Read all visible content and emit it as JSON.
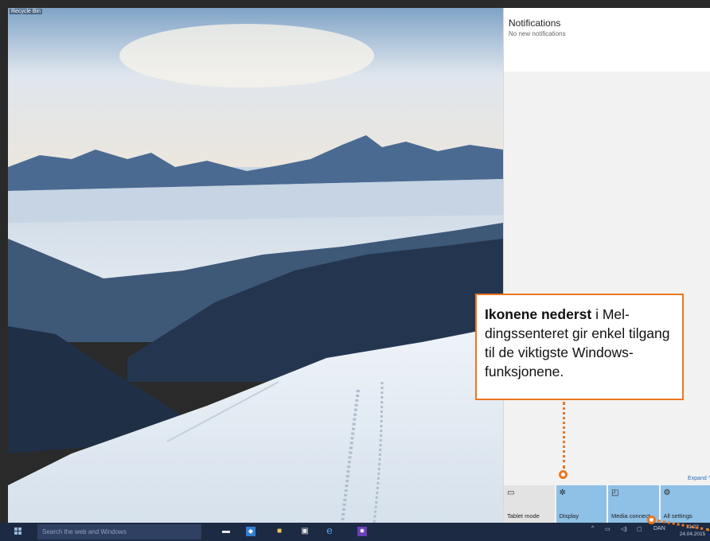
{
  "desktop": {
    "recycle_label": "Recycle Bin"
  },
  "action_center": {
    "title": "Notifications",
    "subtitle": "No new notifications",
    "expand": "Expand",
    "expand_icon": "chevron-up-icon",
    "tiles": [
      {
        "label": "Tablet mode",
        "icon": "tablet-icon",
        "glyph": "▭",
        "state": "off"
      },
      {
        "label": "Display",
        "icon": "brightness-icon",
        "glyph": "✲",
        "state": "on"
      },
      {
        "label": "Media connect",
        "icon": "connect-icon",
        "glyph": "◰",
        "state": "on"
      },
      {
        "label": "All settings",
        "icon": "gear-icon",
        "glyph": "⚙",
        "state": "on"
      }
    ]
  },
  "callout": {
    "bold": "Ikonene nederst",
    "rest": " i Mel-dingssenteret gir enkel tilgang til de viktigste Windows-funksjonene."
  },
  "taskbar": {
    "search_placeholder": "Search the web and Windows",
    "tray_lang": "DAN",
    "time": "11:22",
    "date": "24.04.2015"
  },
  "colors": {
    "accent": "#e87722",
    "taskbar": "#1c2a44",
    "tile_on": "#8fc0e6"
  }
}
